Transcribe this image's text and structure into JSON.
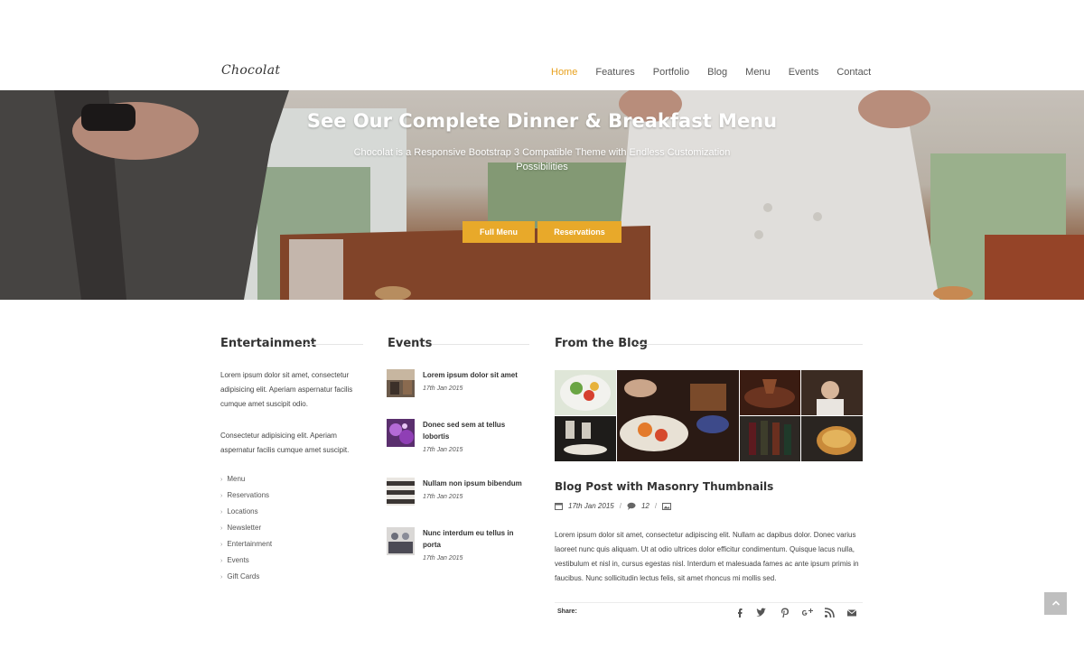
{
  "brand": {
    "logo": "Chocolat",
    "accent": "#e8a21f"
  },
  "nav": {
    "items": [
      "Home",
      "Features",
      "Portfolio",
      "Blog",
      "Menu",
      "Events",
      "Contact"
    ],
    "active": "Home"
  },
  "hero": {
    "title": "See Our Complete Dinner & Breakfast Menu",
    "subtitle": "Chocolat is a Responsive Bootstrap 3 Compatible Theme with Endless Customization Possibilities",
    "buttons": {
      "full_menu": "Full Menu",
      "reservations": "Reservations"
    }
  },
  "entertainment": {
    "heading": "Entertainment",
    "paragraph1": "Lorem ipsum dolor sit amet, consectetur adipisicing elit. Aperiam aspernatur facilis cumque amet suscipit odio.",
    "paragraph2": "Consectetur adipisicing elit. Aperiam aspernatur facilis cumque amet suscipit.",
    "links": [
      "Menu",
      "Reservations",
      "Locations",
      "Newsletter",
      "Entertainment",
      "Events",
      "Gift Cards"
    ]
  },
  "events": {
    "heading": "Events",
    "items": [
      {
        "title": "Lorem ipsum dolor sit amet",
        "date": "17th Jan 2015"
      },
      {
        "title": "Donec sed sem at tellus lobortis",
        "date": "17th Jan 2015"
      },
      {
        "title": "Nullam non ipsum bibendum",
        "date": "17th Jan 2015"
      },
      {
        "title": "Nunc interdum eu tellus in porta",
        "date": "17th Jan 2015"
      }
    ]
  },
  "blog": {
    "heading": "From the Blog",
    "post_title": "Blog Post with Masonry Thumbnails",
    "date": "17th Jan 2015",
    "comments": "12",
    "body": "Lorem ipsum dolor sit amet, consectetur adipiscing elit. Nullam ac dapibus dolor. Donec varius laoreet nunc quis aliquam. Ut at odio ultrices dolor efficitur condimentum. Quisque lacus nulla, vestibulum et nisl in, cursus egestas nisl. Interdum et malesuada fames ac ante ipsum primis in faucibus. Nunc sollicitudin lectus felis, sit amet rhoncus mi mollis sed.",
    "share_label": "Share:",
    "social_icons": [
      "facebook-icon",
      "twitter-icon",
      "pinterest-icon",
      "google-plus-icon",
      "rss-icon",
      "email-icon"
    ]
  },
  "back_to_top_icon": "chevron-up-icon"
}
